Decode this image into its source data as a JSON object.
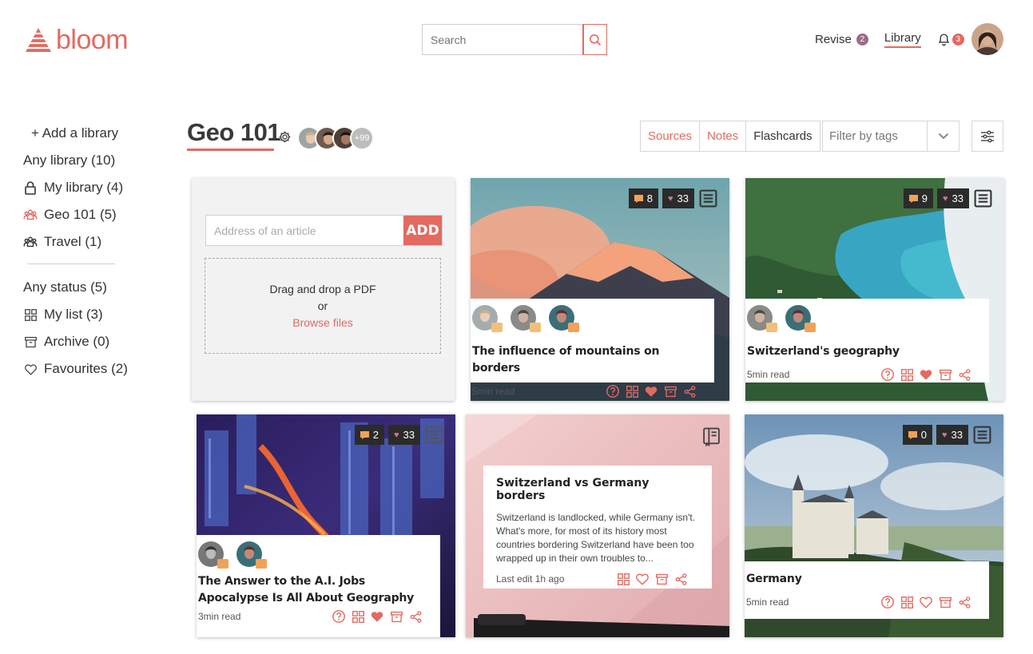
{
  "header": {
    "logo_text": "bloom",
    "search_placeholder": "Search",
    "nav": {
      "revise_label": "Revise",
      "revise_count": "2",
      "library_label": "Library",
      "notif_count": "3"
    }
  },
  "sidebar": {
    "add_library": "+ Add a library",
    "libraries": [
      {
        "label": "Any library (10)",
        "icon": "none",
        "active": false
      },
      {
        "label": "My library (4)",
        "icon": "lock-icon",
        "active": false
      },
      {
        "label": "Geo 101 (5)",
        "icon": "group-icon",
        "active": true
      },
      {
        "label": "Travel (1)",
        "icon": "group-icon",
        "active": false
      }
    ],
    "statuses": [
      {
        "label": "Any status (5)",
        "icon": "none",
        "active": true
      },
      {
        "label": "My list (3)",
        "icon": "grid-icon",
        "active": false
      },
      {
        "label": "Archive (0)",
        "icon": "archive-icon",
        "active": false
      },
      {
        "label": "Favourites (2)",
        "icon": "heart-icon",
        "active": false
      }
    ]
  },
  "main": {
    "title": "Geo 101",
    "members_more": "+99",
    "tabs": [
      "Sources",
      "Notes",
      "Flashcards"
    ],
    "filter_placeholder": "Filter by tags"
  },
  "upload": {
    "address_placeholder": "Address of an article",
    "add_label": "ADD",
    "drop_line1": "Drag and drop a PDF",
    "drop_line2": "or",
    "browse_label": "Browse files"
  },
  "cards": [
    {
      "title": "The influence of mountains on borders",
      "comments": "8",
      "likes": "33",
      "read": "5min read"
    },
    {
      "title": "Switzerland's geography",
      "comments": "9",
      "likes": "33",
      "read": "5min read"
    },
    {
      "title": "The Answer to the A.I. Jobs Apocalypse Is All About Geography",
      "comments": "2",
      "likes": "33",
      "read": "3min read"
    },
    {
      "title": "Germany",
      "comments": "0",
      "likes": "33",
      "read": "5min read"
    }
  ],
  "note": {
    "title": "Switzerland vs Germany borders",
    "text": "Switzerland is landlocked, while Germany isn't. What's more, for most of its history most countries bordering Switzerland have been too wrapped up in their own troubles to...",
    "meta": "Last edit 1h ago"
  },
  "colors": {
    "accent": "#e26a61",
    "revise_badge": "#9c6b8c",
    "notif_badge": "#e26a61",
    "author_tag": "#f0a25a"
  }
}
